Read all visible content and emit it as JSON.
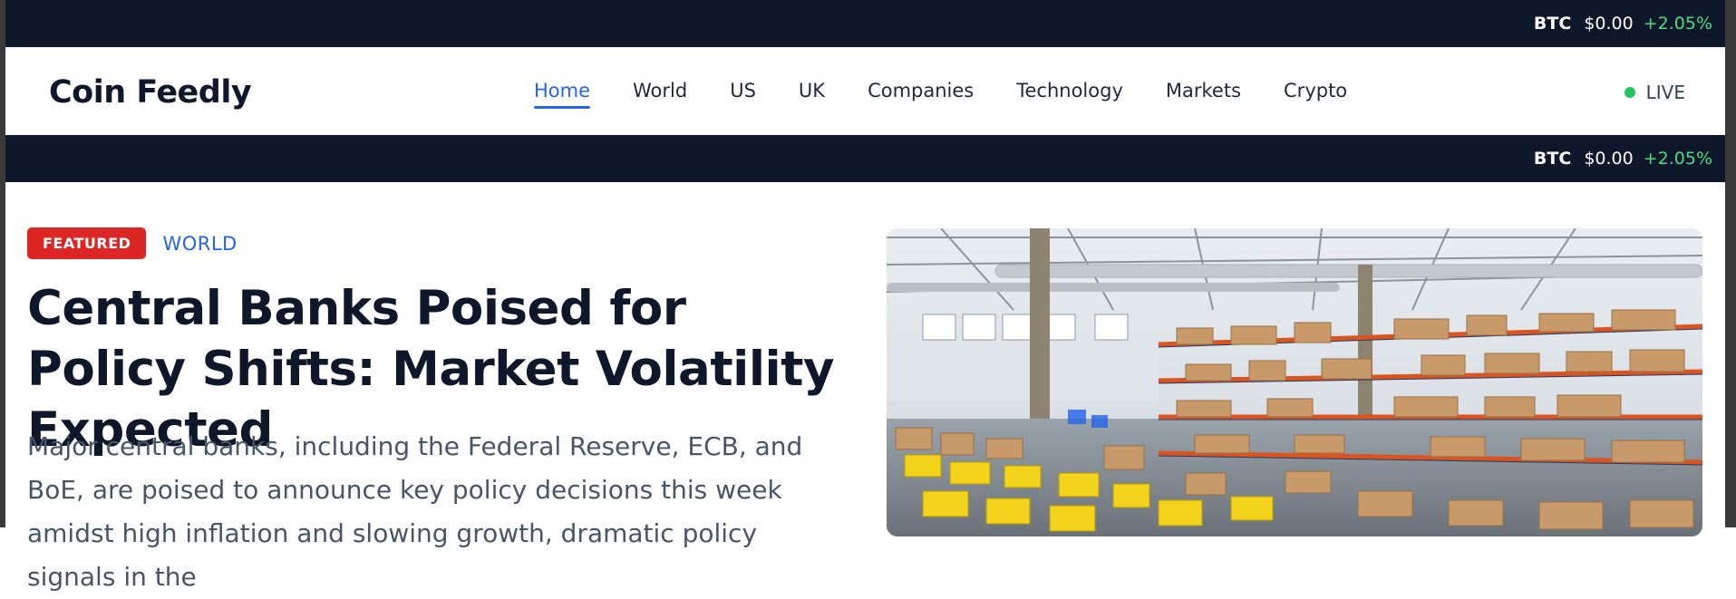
{
  "ticker_top": {
    "symbol": "BTC",
    "price": "$0.00",
    "change": "+2.05%"
  },
  "ticker_bottom": {
    "symbol": "BTC",
    "price": "$0.00",
    "change": "+2.05%"
  },
  "header": {
    "brand": "Coin Feedly",
    "nav": [
      "Home",
      "World",
      "US",
      "UK",
      "Companies",
      "Technology",
      "Markets",
      "Crypto"
    ],
    "active": "Home",
    "live_label": "LIVE"
  },
  "featured": {
    "badge": "FEATURED",
    "category": "WORLD",
    "headline": "Central Banks Poised for Policy Shifts: Market Volatility Expected",
    "summary": "Major central banks, including the Federal Reserve, ECB, and BoE, are poised to announce key policy decisions this week amidst high inflation and slowing growth, dramatic policy signals in the",
    "image_alt": "warehouse-photo"
  },
  "colors": {
    "dark": "#0f172a",
    "accent": "#2563eb",
    "badge": "#dc2626",
    "positive": "#4ade80",
    "live": "#22c55e"
  }
}
